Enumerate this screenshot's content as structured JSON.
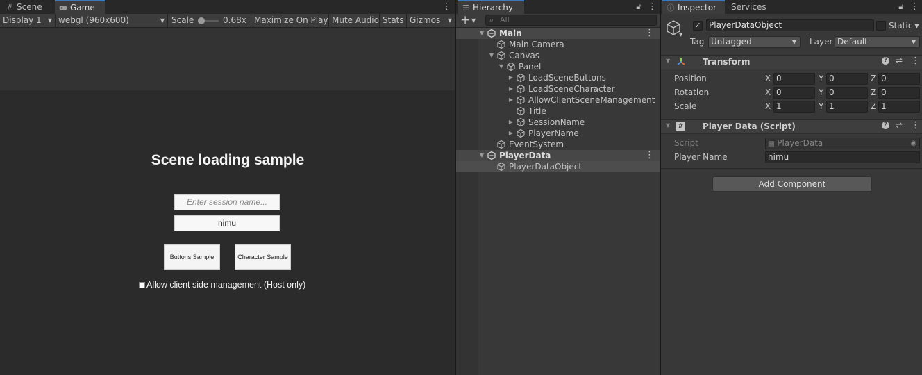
{
  "game_panel": {
    "tabs": [
      {
        "label": "Scene",
        "icon": "hash-grid-icon"
      },
      {
        "label": "Game",
        "icon": "gamepad-icon"
      }
    ],
    "toolbar": {
      "display": "Display 1",
      "resolution": "webgl (960x600)",
      "scale_label": "Scale",
      "scale_value": "0.68x",
      "maximize": "Maximize On Play",
      "mute": "Mute Audio",
      "stats": "Stats",
      "gizmos": "Gizmos"
    },
    "view": {
      "title": "Scene loading sample",
      "session_placeholder": "Enter session name...",
      "player_name": "nimu",
      "buttons_sample": "Buttons Sample",
      "character_sample": "Character Sample",
      "allow_client": "Allow client side management (Host only)"
    }
  },
  "hierarchy": {
    "tab": "Hierarchy",
    "search_placeholder": "All",
    "items": [
      {
        "label": "Main"
      },
      {
        "label": "Main Camera"
      },
      {
        "label": "Canvas"
      },
      {
        "label": "Panel"
      },
      {
        "label": "LoadSceneButtons"
      },
      {
        "label": "LoadSceneCharacter"
      },
      {
        "label": "AllowClientSceneManagement"
      },
      {
        "label": "Title"
      },
      {
        "label": "SessionName"
      },
      {
        "label": "PlayerName"
      },
      {
        "label": "EventSystem"
      },
      {
        "label": "PlayerData"
      },
      {
        "label": "PlayerDataObject"
      }
    ]
  },
  "inspector": {
    "tabs": [
      {
        "label": "Inspector",
        "icon": "info-icon"
      },
      {
        "label": "Services"
      }
    ],
    "object_name": "PlayerDataObject",
    "static_label": "Static",
    "tag_label": "Tag",
    "tag_value": "Untagged",
    "layer_label": "Layer",
    "layer_value": "Default",
    "transform": {
      "title": "Transform",
      "position_label": "Position",
      "rotation_label": "Rotation",
      "scale_label": "Scale",
      "position": {
        "x": "0",
        "y": "0",
        "z": "0"
      },
      "rotation": {
        "x": "0",
        "y": "0",
        "z": "0"
      },
      "scale": {
        "x": "1",
        "y": "1",
        "z": "1"
      }
    },
    "script_component": {
      "title": "Player Data (Script)",
      "script_label": "Script",
      "script_value": "PlayerData",
      "player_name_label": "Player Name",
      "player_name_value": "nimu"
    },
    "add_component": "Add Component"
  },
  "axis_labels": {
    "x": "X",
    "y": "Y",
    "z": "Z"
  },
  "colors": {
    "accent": "#3a79bb",
    "panel": "#383838",
    "game_bg": "#2b2b2b"
  }
}
